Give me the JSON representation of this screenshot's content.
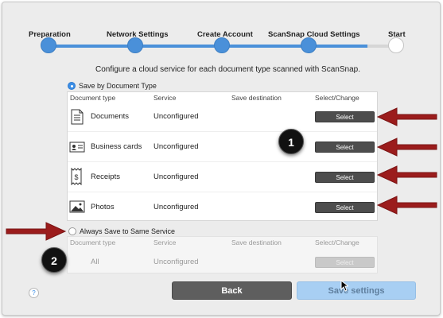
{
  "steps": [
    {
      "label": "Preparation",
      "state": "done"
    },
    {
      "label": "Network Settings",
      "state": "done"
    },
    {
      "label": "Create Account",
      "state": "done"
    },
    {
      "label": "ScanSnap Cloud Settings",
      "state": "current"
    },
    {
      "label": "Start",
      "state": "todo"
    }
  ],
  "intro": "Configure a cloud service for each document type scanned with ScanSnap.",
  "option_by_type": {
    "label": "Save by Document Type",
    "selected": true
  },
  "option_same": {
    "label": "Always Save to Same Service",
    "selected": false
  },
  "headers": {
    "doc_type": "Document type",
    "service": "Service",
    "destination": "Save destination",
    "select_change": "Select/Change"
  },
  "rows": [
    {
      "type": "Documents",
      "icon": "document-icon",
      "service": "Unconfigured",
      "button": "Select"
    },
    {
      "type": "Business cards",
      "icon": "business-card-icon",
      "service": "Unconfigured",
      "button": "Select"
    },
    {
      "type": "Receipts",
      "icon": "receipt-icon",
      "service": "Unconfigured",
      "button": "Select"
    },
    {
      "type": "Photos",
      "icon": "photo-icon",
      "service": "Unconfigured",
      "button": "Select"
    }
  ],
  "same_row": {
    "type": "All",
    "service": "Unconfigured",
    "button": "Select"
  },
  "callouts": [
    "1",
    "2"
  ],
  "buttons": {
    "back": "Back",
    "save": "Save settings",
    "help": "?"
  },
  "colors": {
    "accent": "#4a90d9",
    "arrow": "#9b1c1c",
    "button_dark": "#4d4d4d",
    "save_disabled": "#a8cff3"
  }
}
